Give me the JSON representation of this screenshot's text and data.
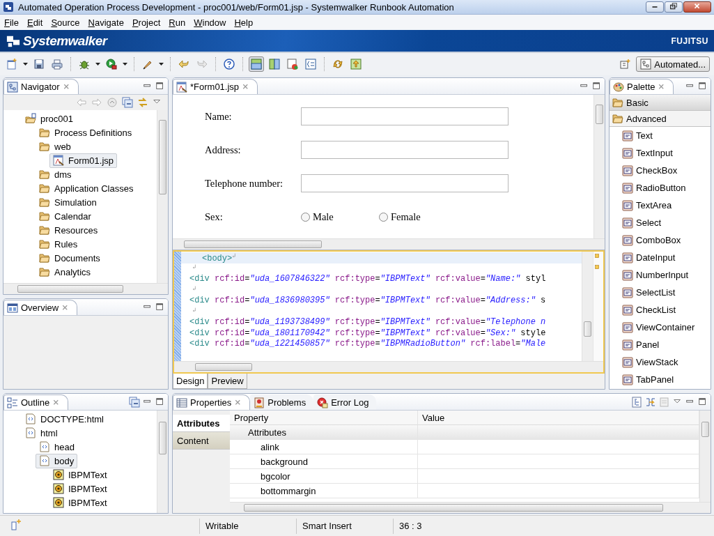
{
  "window": {
    "title": "Automated Operation Process Development - proc001/web/Form01.jsp - Systemwalker Runbook Automation"
  },
  "menu": [
    "File",
    "Edit",
    "Source",
    "Navigate",
    "Project",
    "Run",
    "Window",
    "Help"
  ],
  "banner": {
    "product": "Systemwalker",
    "vendor": "FUJITSU"
  },
  "toolbar": {
    "layout_toggles": [
      {
        "selected": true
      },
      {
        "selected": false
      },
      {
        "selected": false
      },
      {
        "selected": false
      }
    ],
    "perspective": "Automated..."
  },
  "navigator": {
    "title": "Navigator",
    "tree": [
      {
        "label": "proc001",
        "kind": "project",
        "selected": false,
        "children": [
          {
            "label": "Process Definitions",
            "kind": "folder",
            "selected": false
          },
          {
            "label": "web",
            "kind": "folder",
            "selected": false,
            "children": [
              {
                "label": "Form01.jsp",
                "kind": "file",
                "selected": true
              }
            ]
          },
          {
            "label": "dms",
            "kind": "folder",
            "selected": false
          },
          {
            "label": "Application Classes",
            "kind": "folder",
            "selected": false
          },
          {
            "label": "Simulation",
            "kind": "folder",
            "selected": false
          },
          {
            "label": "Calendar",
            "kind": "folder",
            "selected": false
          },
          {
            "label": "Resources",
            "kind": "folder",
            "selected": false
          },
          {
            "label": "Rules",
            "kind": "folder",
            "selected": false
          },
          {
            "label": "Documents",
            "kind": "folder",
            "selected": false
          },
          {
            "label": "Analytics",
            "kind": "folder",
            "selected": false
          }
        ]
      }
    ]
  },
  "overview": {
    "title": "Overview"
  },
  "editor": {
    "tabs": [
      {
        "label": "*Form01.jsp",
        "selected": true
      }
    ],
    "form": [
      {
        "label": "Name:",
        "kind": "input"
      },
      {
        "label": "Address:",
        "kind": "input"
      },
      {
        "label": "Telephone number:",
        "kind": "input"
      },
      {
        "label": "Sex:",
        "kind": "radio",
        "options": [
          {
            "label": "Male",
            "selected": false
          },
          {
            "label": "Female",
            "selected": false
          }
        ]
      }
    ],
    "source": [
      {
        "kind": "code",
        "text": "<body>",
        "current": true
      },
      {
        "kind": "break",
        "current": false
      },
      {
        "kind": "code",
        "text": "<div rcf:id=\"uda_1607846322\" rcf:type=\"IBPMText\" rcf:value=\"Name:\" styl",
        "current": false
      },
      {
        "kind": "break",
        "current": false
      },
      {
        "kind": "code",
        "text": "<div rcf:id=\"uda_1836980395\" rcf:type=\"IBPMText\" rcf:value=\"Address:\" s",
        "current": false
      },
      {
        "kind": "break",
        "current": false
      },
      {
        "kind": "code",
        "text": "<div rcf:id=\"uda_1193738499\" rcf:type=\"IBPMText\" rcf:value=\"Telephone n",
        "current": false
      },
      {
        "kind": "code",
        "text": "<div rcf:id=\"uda_1801170942\" rcf:type=\"IBPMText\" rcf:value=\"Sex:\" style",
        "current": false
      },
      {
        "kind": "code",
        "text": "<div rcf:id=\"uda_1221450857\" rcf:type=\"IBPMRadioButton\" rcf:label=\"Male",
        "current": false
      }
    ],
    "bottom_tabs": [
      {
        "label": "Design",
        "selected": true
      },
      {
        "label": "Preview",
        "selected": false
      }
    ]
  },
  "palette": {
    "title": "Palette",
    "drawers": [
      {
        "label": "Basic",
        "expanded": false
      },
      {
        "label": "Advanced",
        "expanded": true,
        "items": [
          "Text",
          "TextInput",
          "CheckBox",
          "RadioButton",
          "TextArea",
          "Select",
          "ComboBox",
          "DateInput",
          "NumberInput",
          "SelectList",
          "CheckList",
          "ViewContainer",
          "Panel",
          "ViewStack",
          "TabPanel"
        ]
      }
    ]
  },
  "outline": {
    "title": "Outline",
    "tree": [
      {
        "label": "DOCTYPE:html",
        "kind": "tag",
        "selected": false
      },
      {
        "label": "html",
        "kind": "tag",
        "selected": false,
        "children": [
          {
            "label": "head",
            "kind": "tag",
            "selected": false
          },
          {
            "label": "body",
            "kind": "tag",
            "selected": true,
            "children": [
              {
                "label": "IBPMText",
                "kind": "component",
                "selected": false
              },
              {
                "label": "IBPMText",
                "kind": "component",
                "selected": false
              },
              {
                "label": "IBPMText",
                "kind": "component",
                "selected": false
              }
            ]
          }
        ]
      }
    ]
  },
  "properties": {
    "tabs": [
      {
        "label": "Properties",
        "selected": true
      },
      {
        "label": "Problems",
        "selected": false
      },
      {
        "label": "Error Log",
        "selected": false
      }
    ],
    "sections": [
      {
        "label": "Attributes",
        "selected": true
      },
      {
        "label": "Content",
        "selected": false
      }
    ],
    "columns": [
      "Property",
      "Value"
    ],
    "rows": [
      {
        "kind": "category",
        "name": "Attributes"
      },
      {
        "kind": "attribute",
        "name": "alink"
      },
      {
        "kind": "attribute",
        "name": "background"
      },
      {
        "kind": "attribute",
        "name": "bgcolor"
      },
      {
        "kind": "attribute",
        "name": "bottommargin"
      }
    ]
  },
  "status_bar": [
    "Writable",
    "Smart Insert",
    "36 : 3"
  ]
}
